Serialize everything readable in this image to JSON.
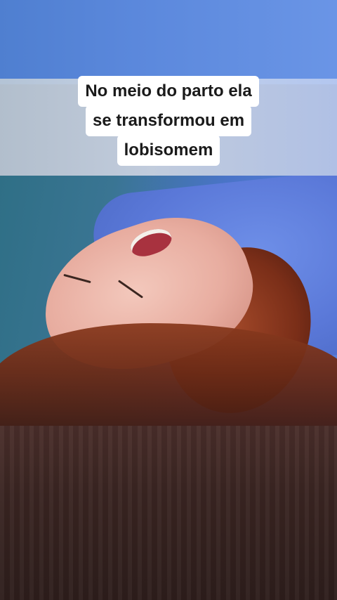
{
  "caption": {
    "lines": [
      "No meio do parto ela",
      "se transformou em",
      "lobisomem"
    ]
  },
  "colors": {
    "caption_background": "#ffffff",
    "caption_text": "#1a1a1a",
    "top_background": "#5b88dc",
    "bottom_background": "#3a2522"
  }
}
